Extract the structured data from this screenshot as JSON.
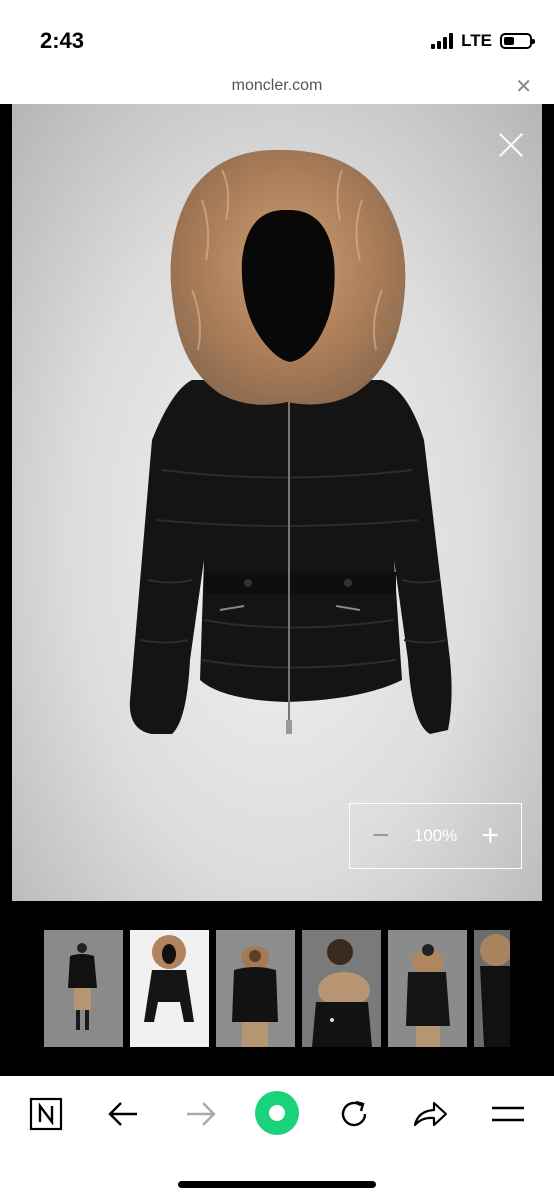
{
  "status_bar": {
    "time": "2:43",
    "network": "LTE",
    "battery_level": 0.4
  },
  "url_bar": {
    "domain": "moncler.com",
    "close_icon": "close-icon"
  },
  "viewer": {
    "zoom": {
      "value": "100%",
      "minus_icon": "minus-icon",
      "plus_icon": "plus-icon"
    },
    "close_icon": "close-icon",
    "image_subject": "black puffer jacket with fur hood",
    "thumbnails": [
      {
        "name": "model-full-front",
        "active": false
      },
      {
        "name": "product-front",
        "active": true
      },
      {
        "name": "model-front-close",
        "active": false
      },
      {
        "name": "model-side",
        "active": false
      },
      {
        "name": "model-back",
        "active": false
      },
      {
        "name": "model-detail",
        "active": false
      }
    ]
  },
  "toolbar": {
    "items": [
      "notion-icon",
      "back-arrow-icon",
      "forward-arrow-icon",
      "record-icon",
      "reload-icon",
      "share-icon",
      "menu-icon"
    ],
    "accent_color": "#1ad27a"
  },
  "colors": {
    "viewer_bg": "#000000",
    "accent": "#1ad27a"
  }
}
